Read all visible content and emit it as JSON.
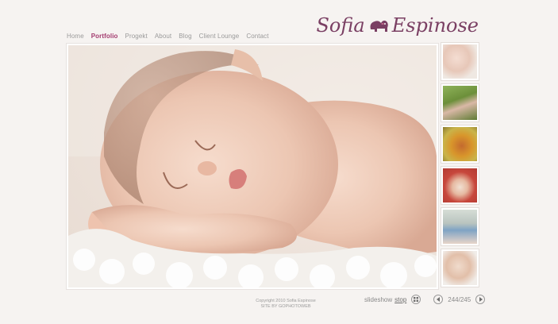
{
  "brand": {
    "name_left": "Sofia",
    "name_right": "Espinose"
  },
  "nav": {
    "items": [
      "Home",
      "Portfolio",
      "Progekt",
      "About",
      "Blog",
      "Client Lounge",
      "Contact"
    ],
    "active": "Portfolio"
  },
  "thumbnails": [
    {
      "name": "thumb-newborn-sleeping"
    },
    {
      "name": "thumb-family-outdoors"
    },
    {
      "name": "thumb-couple-autumn"
    },
    {
      "name": "thumb-baby-red-blanket"
    },
    {
      "name": "thumb-toddler-walking"
    },
    {
      "name": "thumb-newborn-white"
    }
  ],
  "footer": {
    "copyright": "Copyright 2010 Sofia Espinose",
    "credit": "SITE BY GOPHOTOWEB"
  },
  "slideshow": {
    "label": "slideshow",
    "stop": "stop",
    "counter": "244/245"
  },
  "icons": {
    "grid": "grid-icon",
    "prev": "prev-arrow-icon",
    "next": "next-arrow-icon",
    "elephant": "elephant-icon"
  },
  "colors": {
    "accent": "#a33b6f",
    "background": "#f6f3f1"
  }
}
